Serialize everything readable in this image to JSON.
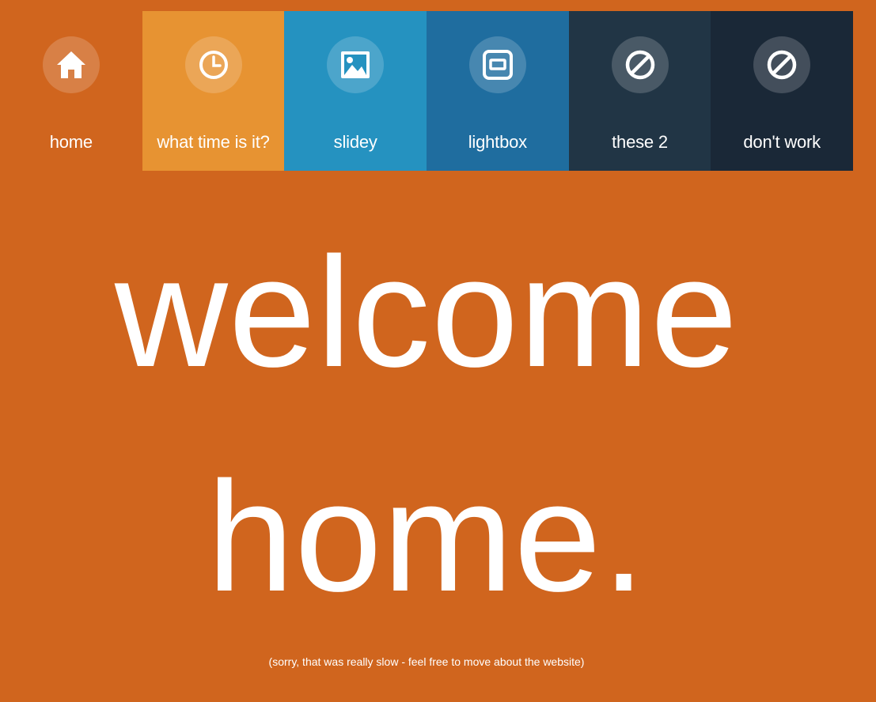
{
  "nav": {
    "items": [
      {
        "label": "home",
        "icon": "home-icon",
        "color": "#d0651e"
      },
      {
        "label": "what time is it?",
        "icon": "clock-icon",
        "color": "#e79332"
      },
      {
        "label": "slidey",
        "icon": "image-icon",
        "color": "#2592c0"
      },
      {
        "label": "lightbox",
        "icon": "lightbox-icon",
        "color": "#1f6d9f"
      },
      {
        "label": "these 2",
        "icon": "ban-icon",
        "color": "#213545"
      },
      {
        "label": "don't work",
        "icon": "ban-icon",
        "color": "#1a2837"
      }
    ]
  },
  "hero": {
    "line1": "welcome",
    "line2": "home."
  },
  "note": "(sorry, that was really slow - feel free to move about the website)",
  "colors": {
    "background": "#d0651e",
    "text": "#ffffff"
  }
}
